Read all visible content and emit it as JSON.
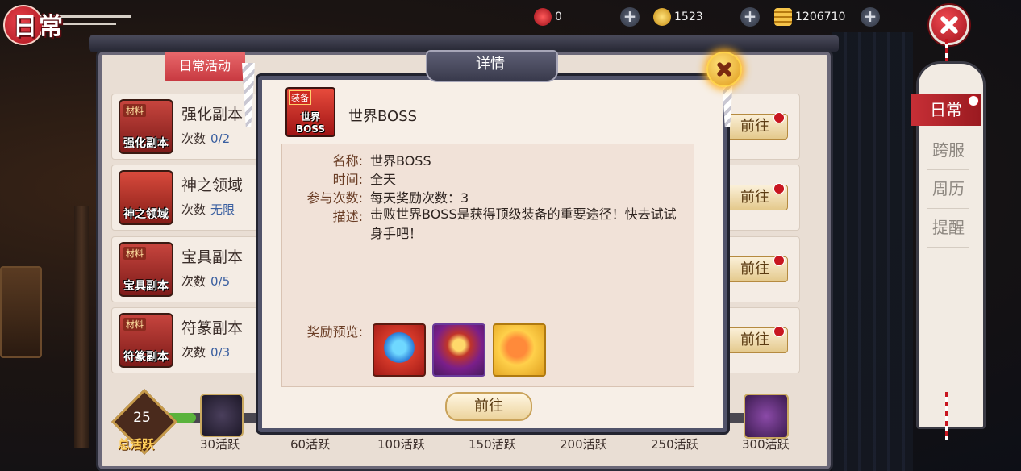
{
  "header": {
    "title": "日常",
    "currencies": [
      {
        "icon": "red-jade-icon",
        "value": "0"
      },
      {
        "icon": "gold-ingot-icon",
        "value": "1523"
      },
      {
        "icon": "coin-stack-icon",
        "value": "1206710"
      }
    ],
    "plus_symbol": "+"
  },
  "tabs": {
    "daily": "日常活动"
  },
  "activities": [
    {
      "name": "强化副本",
      "icon_tag": "材料",
      "icon_label": "强化副本",
      "count_label": "次数",
      "count": "0/2"
    },
    {
      "name": "神之领域",
      "icon_tag": "",
      "icon_label": "神之领域",
      "count_label": "次数",
      "count": "无限"
    },
    {
      "name": "宝具副本",
      "icon_tag": "材料",
      "icon_label": "宝具副本",
      "count_label": "次数",
      "count": "0/5"
    },
    {
      "name": "符篆副本",
      "icon_tag": "材料",
      "icon_label": "符篆副本",
      "count_label": "次数",
      "count": "0/3"
    }
  ],
  "go_label": "前往",
  "activity_bar": {
    "total": "25",
    "total_label": "总活跃",
    "progress_fraction": 0.06,
    "milestones": [
      "30活跃",
      "60活跃",
      "100活跃",
      "150活跃",
      "200活跃",
      "250活跃",
      "300活跃"
    ]
  },
  "side_tabs": [
    "日常",
    "跨服",
    "周历",
    "提醒"
  ],
  "dialog": {
    "title": "详情",
    "boss": {
      "name": "世界BOSS",
      "icon_tag": "装备",
      "icon_label": "世界BOSS"
    },
    "fields": {
      "name_label": "名称:",
      "name_value": "世界BOSS",
      "time_label": "时间:",
      "time_value": "全天",
      "times_label": "参与次数:",
      "times_value": "每天奖励次数：3",
      "desc_label": "描述:",
      "desc_value": "击败世界BOSS是获得顶级装备的重要途径！快去试试身手吧！",
      "reward_label": "奖励预览:"
    },
    "rewards": [
      "blue-crystal-icon",
      "treasure-chest-icon",
      "orange-gem-icon"
    ],
    "go_button": "前往"
  }
}
